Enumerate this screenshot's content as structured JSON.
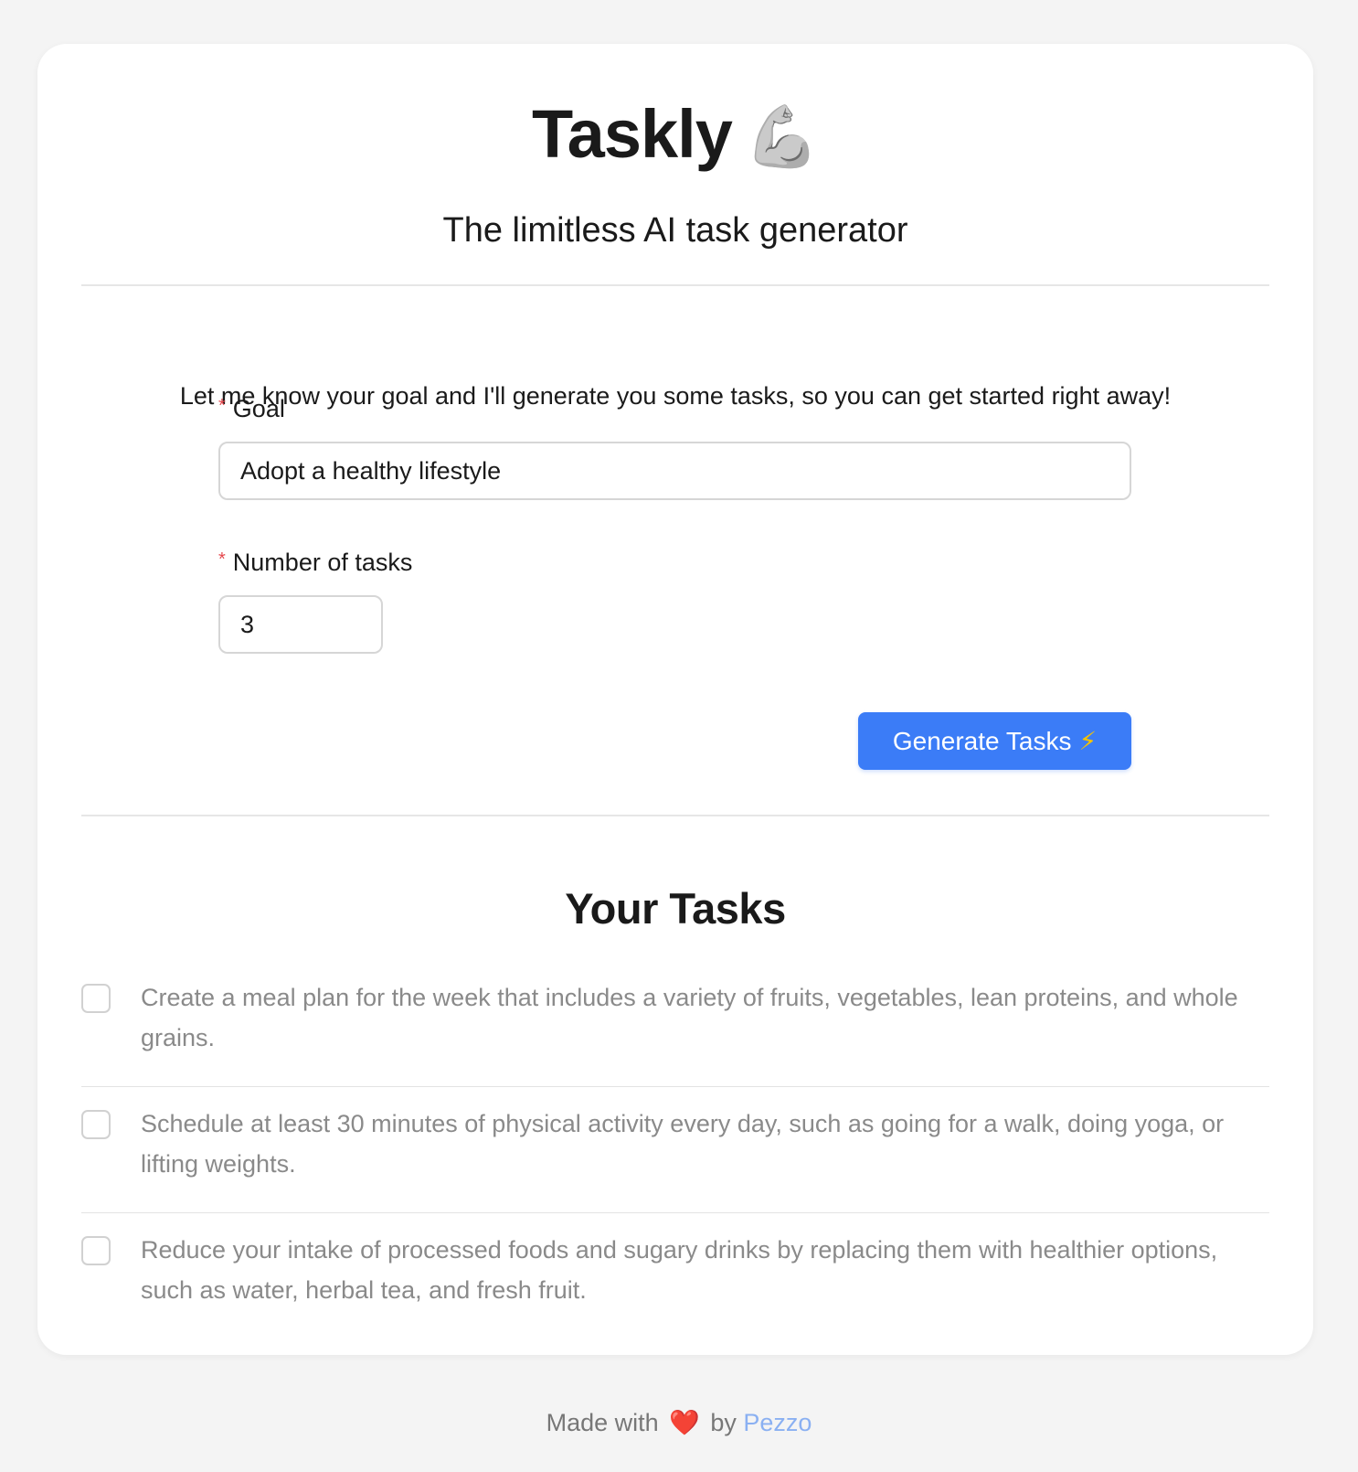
{
  "app": {
    "title": "Taskly",
    "title_emoji": "💪",
    "subtitle": "The limitless AI task generator"
  },
  "form": {
    "intro": "Let me know your goal and I'll generate you some tasks, so you can get started right away!",
    "goal": {
      "required_mark": "*",
      "label": "Goal",
      "value": "Adopt a healthy lifestyle"
    },
    "num_tasks": {
      "required_mark": "*",
      "label": "Number of tasks",
      "value": "3"
    },
    "generate_button": {
      "label": "Generate Tasks",
      "icon": "⚡"
    }
  },
  "tasks_section": {
    "title": "Your Tasks",
    "tasks": [
      {
        "text": "Create a meal plan for the week that includes a variety of fruits, vegetables, lean proteins, and whole grains.",
        "checked": false
      },
      {
        "text": "Schedule at least 30 minutes of physical activity every day, such as going for a walk, doing yoga, or lifting weights.",
        "checked": false
      },
      {
        "text": "Reduce your intake of processed foods and sugary drinks by replacing them with healthier options, such as water, herbal tea, and fresh fruit.",
        "checked": false
      }
    ]
  },
  "footer": {
    "prefix": "Made with",
    "heart": "❤️",
    "by": "by",
    "link_text": "Pezzo"
  },
  "colors": {
    "accent": "#3b7cf7",
    "required": "#e5484d",
    "link": "#8ab0f2",
    "background": "#f4f4f4"
  }
}
